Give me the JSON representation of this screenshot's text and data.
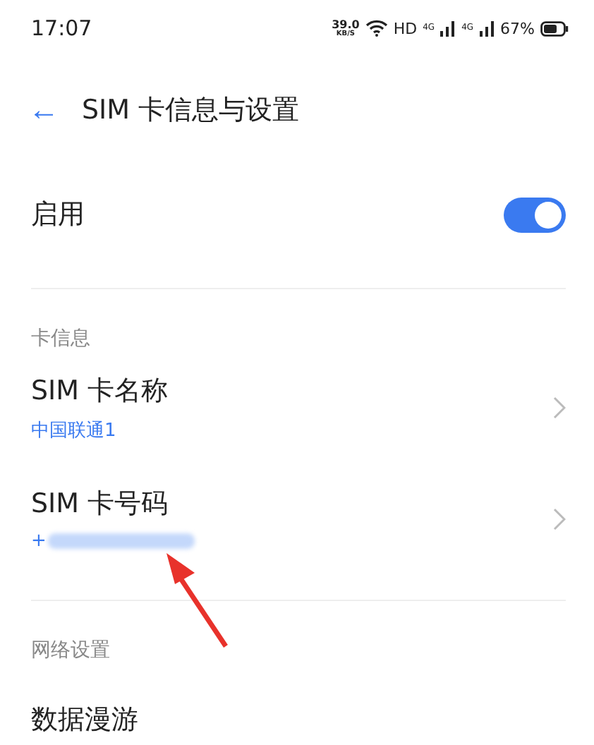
{
  "status_bar": {
    "time": "17:07",
    "speed": "39.0",
    "speed_unit": "KB/S",
    "hd": "HD",
    "network_1": "4G",
    "network_2": "4G",
    "battery": "67%"
  },
  "header": {
    "back": "←",
    "title": "SIM 卡信息与设置"
  },
  "enable": {
    "label": "启用",
    "on": true
  },
  "sections": [
    {
      "heading": "卡信息",
      "items": [
        {
          "title": "SIM 卡名称",
          "subtitle": "中国联通1",
          "redacted": false
        },
        {
          "title": "SIM 卡号码",
          "subtitle": "+",
          "redacted": true
        }
      ]
    },
    {
      "heading": "网络设置",
      "items": [
        {
          "title": "数据漫游"
        }
      ]
    }
  ]
}
